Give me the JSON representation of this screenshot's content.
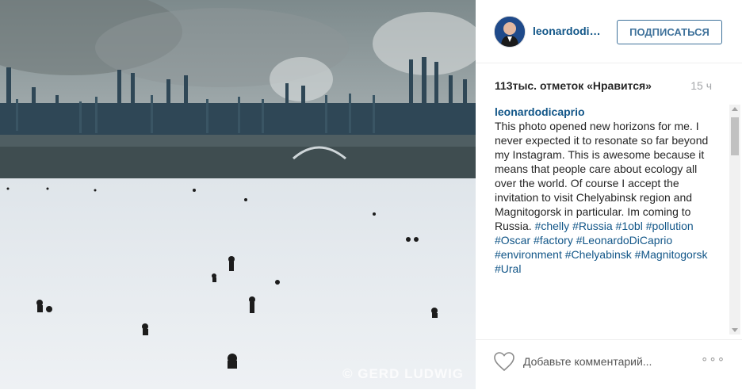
{
  "photo": {
    "description_icon": "photo-icon",
    "watermark": "© GERD LUDWIG"
  },
  "header": {
    "username": "leonardodicaprio",
    "follow_label": "ПОДПИСАТЬСЯ"
  },
  "stats": {
    "likes": "113тыс. отметок «Нравится»",
    "time": "15 ч"
  },
  "caption": {
    "author": "leonardodicaprio",
    "text": "  This photo opened new horizons for me. I never expected it to resonate so far beyond my Instagram. This is awesome because it means that people care about ecology all over the world. Of course I accept the invitation to visit Chelyabinsk region and Magnitogorsk in particular. Im coming to Russia. ",
    "hashtags": [
      "#chelly",
      "#Russia",
      "#1obl",
      "#pollution",
      "#Oscar",
      "#factory",
      "#LeonardoDiCaprio",
      "#environment",
      "#Chelyabinsk",
      "#Magnitogorsk",
      "#Ural"
    ]
  },
  "footer": {
    "comment_placeholder": "Добавьте комментарий...",
    "more_label": "∘∘∘",
    "heart_icon": "heart-icon",
    "more_icon": "more-options-icon"
  },
  "colors": {
    "link": "#125688",
    "follow_border": "#3f729b",
    "muted": "#a5a7aa"
  }
}
